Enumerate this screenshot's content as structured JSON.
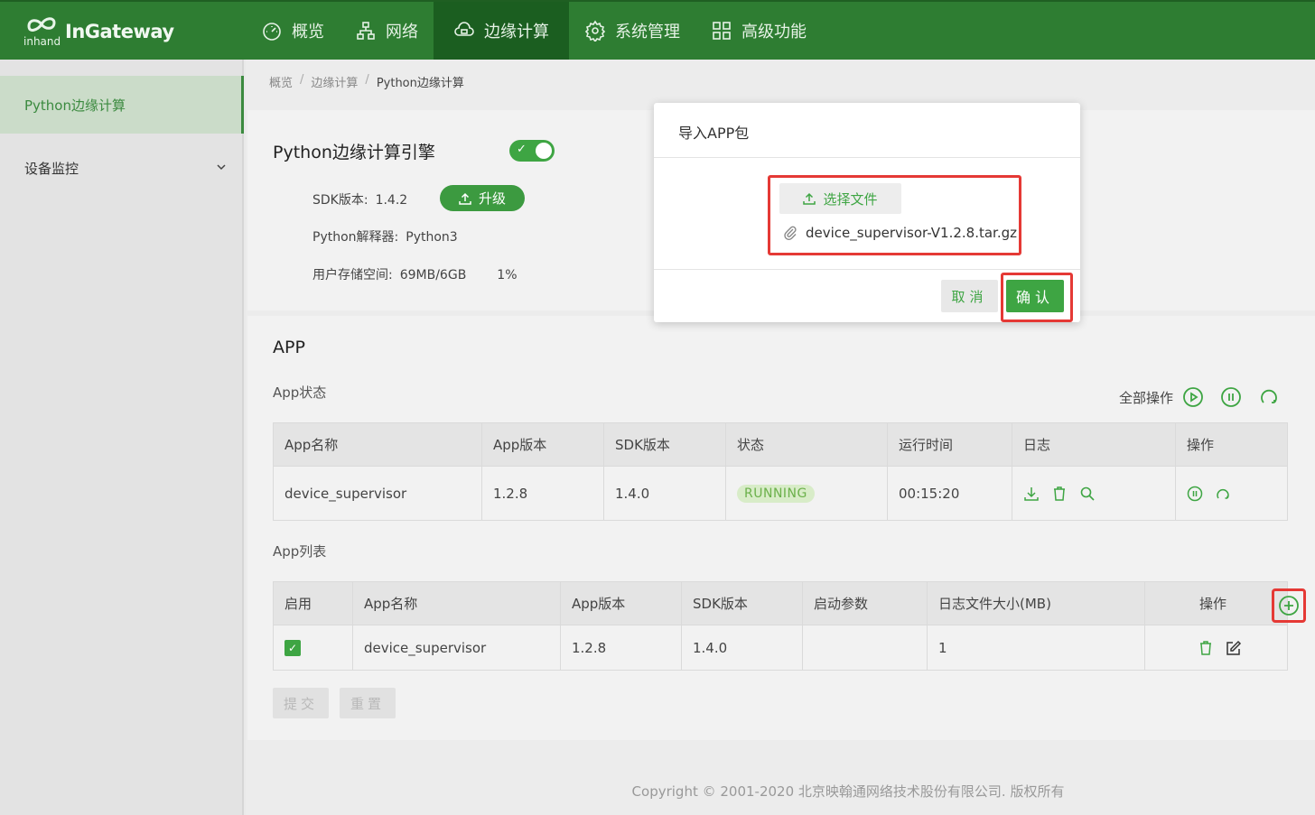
{
  "colors": {
    "brand": "#2e7d32",
    "accent": "#3ea543",
    "highlight": "#e53935"
  },
  "header": {
    "logo_text": "InGateway",
    "logo_mark_text": "inhand",
    "nav": [
      {
        "label": "概览",
        "icon": "dashboard-icon"
      },
      {
        "label": "网络",
        "icon": "network-icon"
      },
      {
        "label": "边缘计算",
        "icon": "cloud-compute-icon",
        "active": true
      },
      {
        "label": "系统管理",
        "icon": "gear-icon"
      },
      {
        "label": "高级功能",
        "icon": "grid-icon"
      }
    ]
  },
  "sidebar": {
    "items": [
      {
        "label": "Python边缘计算",
        "active": true
      },
      {
        "label": "设备监控",
        "expandable": true
      }
    ]
  },
  "breadcrumb": [
    "概览",
    "边缘计算",
    "Python边缘计算"
  ],
  "breadcrumb_sep": "/",
  "engine": {
    "title": "Python边缘计算引擎",
    "toggle_on": true,
    "toggle_mark": "✓",
    "sdk_label": "SDK版本:",
    "sdk_value": "1.4.2",
    "upgrade_label": "升级",
    "interpreter_label": "Python解释器:",
    "interpreter_value": "Python3",
    "storage_label": "用户存储空间:",
    "storage_value": "69MB/6GB",
    "storage_percent": "1%"
  },
  "app_section": {
    "title": "APP",
    "status_title": "App状态",
    "all_ops_label": "全部操作",
    "status_table": {
      "headers": [
        "App名称",
        "App版本",
        "SDK版本",
        "状态",
        "运行时间",
        "日志",
        "操作"
      ],
      "rows": [
        {
          "name": "device_supervisor",
          "app_version": "1.2.8",
          "sdk_version": "1.4.0",
          "status": "RUNNING",
          "uptime": "00:15:20"
        }
      ]
    },
    "list_title": "App列表",
    "list_table": {
      "headers": [
        "启用",
        "App名称",
        "App版本",
        "SDK版本",
        "启动参数",
        "日志文件大小(MB)",
        "操作"
      ],
      "rows": [
        {
          "enabled": true,
          "name": "device_supervisor",
          "app_version": "1.2.8",
          "sdk_version": "1.4.0",
          "params": "",
          "log_size": "1"
        }
      ]
    },
    "submit_label": "提交",
    "reset_label": "重置"
  },
  "footer": {
    "text": "Copyright © 2001-2020 北京映翰通网络技术股份有限公司. 版权所有"
  },
  "modal": {
    "title": "导入APP包",
    "choose_file_label": "选择文件",
    "file_name": "device_supervisor-V1.2.8.tar.gz",
    "cancel_label": "取消",
    "ok_label": "确认"
  }
}
